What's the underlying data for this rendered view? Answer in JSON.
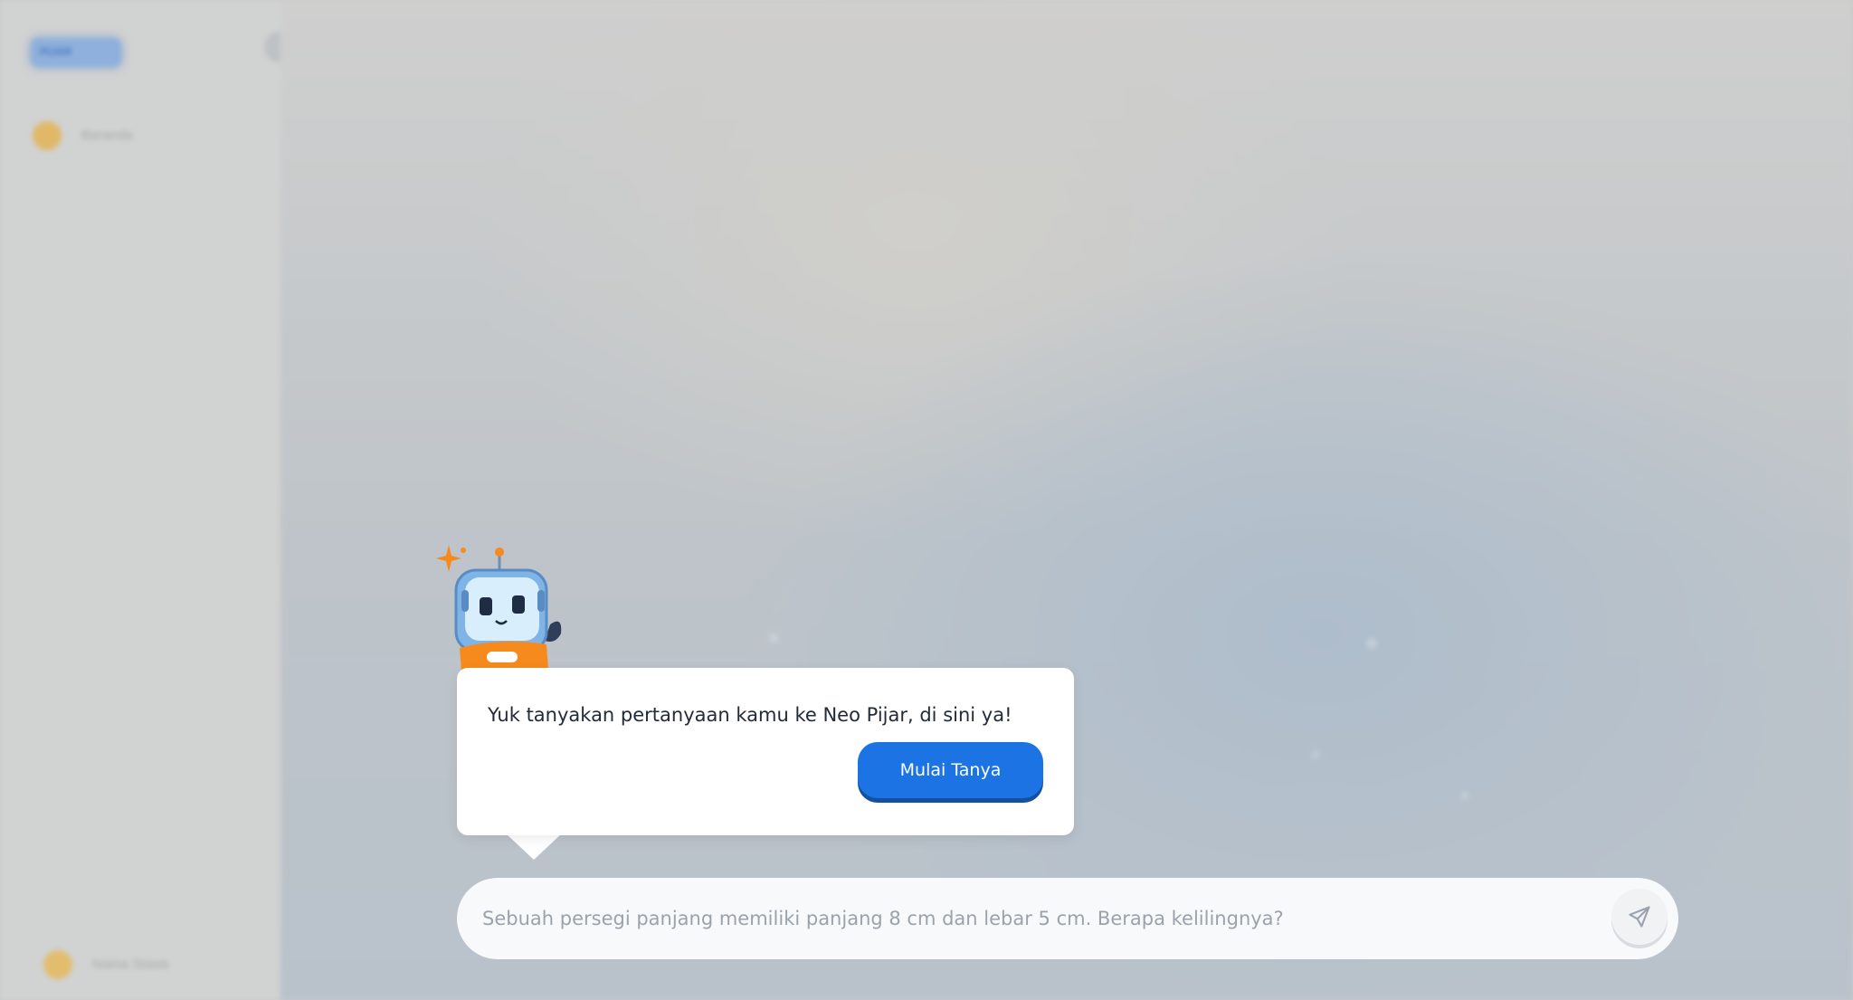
{
  "background_app": {
    "sidebar": {
      "logo_text": "PIJAR",
      "nav_item_label": "Beranda",
      "profile_label": "Nama Siswa"
    }
  },
  "prompt_card": {
    "message": "Yuk tanyakan pertanyaan kamu ke Neo Pijar, di sini ya!",
    "start_button_label": "Mulai Tanya"
  },
  "chat_input": {
    "placeholder": "Sebuah persegi panjang memiliki panjang 8 cm dan lebar 5 cm. Berapa kelilingnya?",
    "send_icon": "send-icon"
  },
  "colors": {
    "accent": "#1b73e4",
    "mascot_orange": "#f78a1d",
    "mascot_blue": "#7fb5e6",
    "overlay_bg": "#c9cacb"
  }
}
